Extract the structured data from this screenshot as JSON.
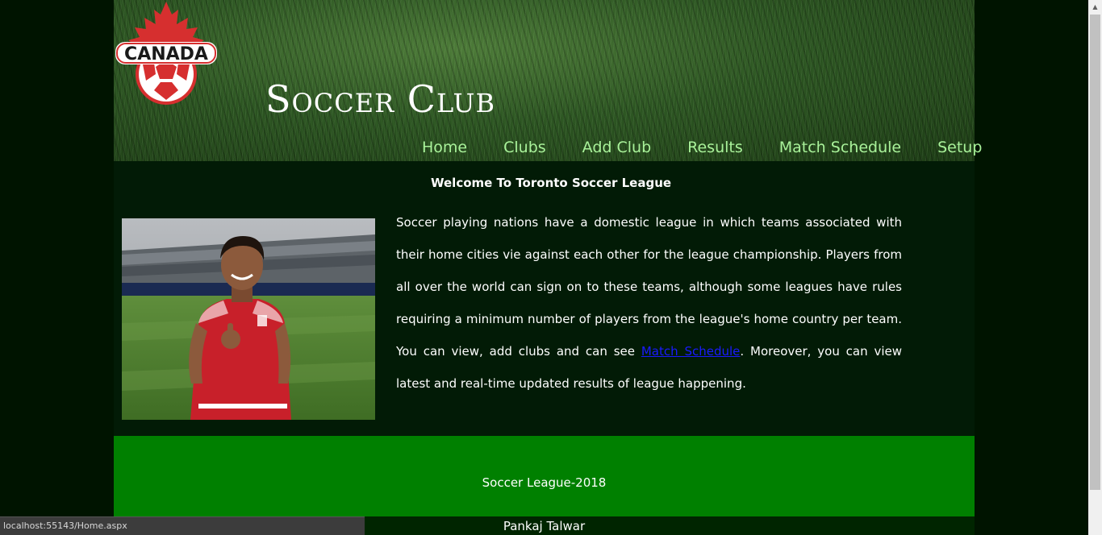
{
  "header": {
    "logo_text": "CANADA",
    "site_title": "Soccer Club",
    "nav": [
      {
        "label": "Home"
      },
      {
        "label": "Clubs"
      },
      {
        "label": "Add Club"
      },
      {
        "label": "Results"
      },
      {
        "label": "Match Schedule"
      },
      {
        "label": "Setup"
      }
    ]
  },
  "main": {
    "welcome": "Welcome To Toronto Soccer League",
    "intro_text_1": "Soccer playing nations have a domestic league in which teams associated with their home cities vie against each other for the league championship. Players from all over the world can sign on to these teams, although some leagues have rules requiring a minimum number of players from the league's home country per team. You can view, add clubs and can see ",
    "intro_link": "Match Schedule",
    "intro_text_2": ". Moreover, you can view latest and real-time updated results of league happening."
  },
  "footer": {
    "title": "Soccer League-2018",
    "author": "Pankaj Talwar"
  },
  "browser": {
    "status_url": "localhost:55143/Home.aspx"
  },
  "colors": {
    "page_bg": "#001400",
    "content_bg": "#021b06",
    "nav_text": "#a9f29a",
    "footer_green": "#008000",
    "link": "#1a1aff"
  }
}
